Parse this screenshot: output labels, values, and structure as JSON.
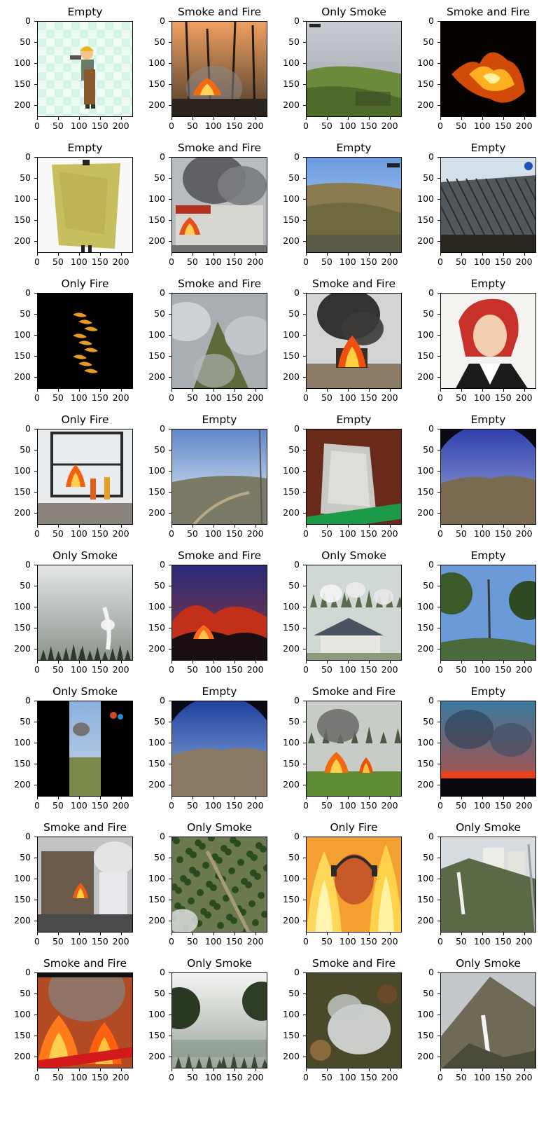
{
  "grid": {
    "tick_labels": [
      "0",
      "50",
      "100",
      "150",
      "200"
    ],
    "panels": [
      {
        "title": "Empty",
        "scene": "cartoon-worker"
      },
      {
        "title": "Smoke and Fire",
        "scene": "forest-fire-night"
      },
      {
        "title": "Only Smoke",
        "scene": "grass-hillside"
      },
      {
        "title": "Smoke and Fire",
        "scene": "flames-dark"
      },
      {
        "title": "Empty",
        "scene": "yellow-sheet"
      },
      {
        "title": "Smoke and Fire",
        "scene": "building-fire"
      },
      {
        "title": "Empty",
        "scene": "dry-hills"
      },
      {
        "title": "Empty",
        "scene": "tiled-roof"
      },
      {
        "title": "Only Fire",
        "scene": "flame-streaks-dark"
      },
      {
        "title": "Smoke and Fire",
        "scene": "smoky-forest"
      },
      {
        "title": "Smoke and Fire",
        "scene": "burning-car"
      },
      {
        "title": "Empty",
        "scene": "anime-portrait"
      },
      {
        "title": "Only Fire",
        "scene": "firefighters-tower"
      },
      {
        "title": "Empty",
        "scene": "fisheye-valley-tower"
      },
      {
        "title": "Empty",
        "scene": "plastic-bag"
      },
      {
        "title": "Empty",
        "scene": "fisheye-valley-blue"
      },
      {
        "title": "Only Smoke",
        "scene": "foggy-forest-smoke"
      },
      {
        "title": "Smoke and Fire",
        "scene": "night-wildfire"
      },
      {
        "title": "Only Smoke",
        "scene": "village-chimneys"
      },
      {
        "title": "Empty",
        "scene": "tree-tower"
      },
      {
        "title": "Only Smoke",
        "scene": "phone-video-smoke"
      },
      {
        "title": "Empty",
        "scene": "fisheye-landscape"
      },
      {
        "title": "Smoke and Fire",
        "scene": "grass-fire-debris"
      },
      {
        "title": "Empty",
        "scene": "sunset-sky"
      },
      {
        "title": "Smoke and Fire",
        "scene": "factory-fire"
      },
      {
        "title": "Only Smoke",
        "scene": "aerial-forest-smoke"
      },
      {
        "title": "Only Fire",
        "scene": "man-in-flames"
      },
      {
        "title": "Only Smoke",
        "scene": "mountain-city-smoke"
      },
      {
        "title": "Smoke and Fire",
        "scene": "news-wildfire"
      },
      {
        "title": "Only Smoke",
        "scene": "foggy-trees-cam"
      },
      {
        "title": "Smoke and Fire",
        "scene": "aerial-smoke-plume"
      },
      {
        "title": "Only Smoke",
        "scene": "mountain-smoke-cam"
      }
    ]
  }
}
